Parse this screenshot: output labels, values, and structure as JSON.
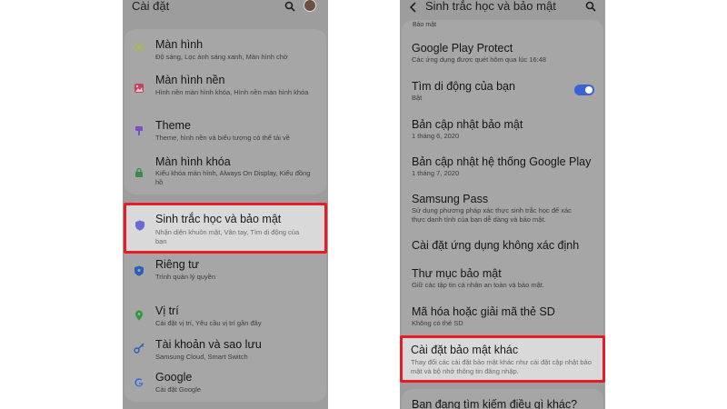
{
  "left": {
    "header_title": "Cài đặt",
    "items": [
      {
        "title": "Màn hình",
        "subtitle": "Độ sáng, Lọc ánh sáng xanh, Màn hình chờ"
      },
      {
        "title": "Màn hình nền",
        "subtitle": "Hình nền màn hình khóa, Hình nền màn hình khóa"
      },
      {
        "title": "Theme",
        "subtitle": "Theme, hình nền và biểu tượng có thể tải về"
      },
      {
        "title": "Màn hình khóa",
        "subtitle": "Kiểu khóa màn hình, Always On Display, Kiểu đồng hồ"
      },
      {
        "title": "Sinh trắc học và bảo mật",
        "subtitle": "Nhận diện khuôn mặt, Vân tay, Tìm di động của bạn"
      },
      {
        "title": "Riêng tư",
        "subtitle": "Trình quản lý quyền"
      },
      {
        "title": "Vị trí",
        "subtitle": "Cài đặt vị trí, Yêu cầu vị trí gần đây"
      },
      {
        "title": "Tài khoản và sao lưu",
        "subtitle": "Samsung Cloud, Smart Switch"
      },
      {
        "title": "Google",
        "subtitle": "Cài đặt Google"
      }
    ]
  },
  "right": {
    "header_title": "Sinh trắc học và bảo mật",
    "section_label": "Bảo mật",
    "items": [
      {
        "title": "Google Play Protect",
        "subtitle": "Các ứng dụng được quét hôm qua lúc 16:48"
      },
      {
        "title": "Tìm di động của bạn",
        "subtitle": "Bật"
      },
      {
        "title": "Bản cập nhật bảo mật",
        "subtitle": "1 tháng 6, 2020"
      },
      {
        "title": "Bản cập nhật hệ thống Google Play",
        "subtitle": "1 tháng 7, 2020"
      },
      {
        "title": "Samsung Pass",
        "subtitle": "Sử dụng phương pháp xác thực sinh trắc học để xác thực danh tính của bạn dễ dàng và bảo mật."
      },
      {
        "title": "Cài đặt ứng dụng không xác định",
        "subtitle": ""
      },
      {
        "title": "Thư mục bảo mật",
        "subtitle": "Giữ các tập tin cá nhân an toàn và bảo mật."
      },
      {
        "title": "Mã hóa hoặc giải mã thẻ SD",
        "subtitle": "Không có thẻ SD"
      },
      {
        "title": "Cài đặt bảo mật khác",
        "subtitle": "Thay đổi các cài đặt bảo mật khác như cài đặt cập nhật bảo mật và bộ nhớ thông tin đăng nhập."
      }
    ],
    "footer_title": "Bạn đang tìm kiếm điều gì khác?"
  },
  "colors": {
    "highlight_border": "#e41e26",
    "toggle_on": "#3b63d3"
  },
  "icons": {
    "left_items": [
      "sun-icon",
      "wallpaper-icon",
      "theme-brush-icon",
      "lock-icon",
      "shield-icon",
      "privacy-shield-icon",
      "location-pin-icon",
      "key-icon",
      "google-g-icon"
    ]
  }
}
